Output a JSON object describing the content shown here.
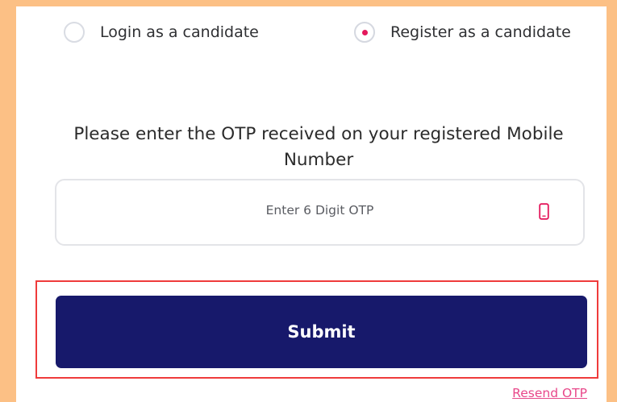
{
  "mode_selector": {
    "options": [
      {
        "label": "Login as a candidate",
        "selected": false
      },
      {
        "label": "Register as a candidate",
        "selected": true
      }
    ]
  },
  "otp_section": {
    "instruction": "Please enter the OTP received on your registered Mobile Number",
    "input_placeholder": "Enter 6 Digit OTP",
    "input_value": "",
    "input_icon": "mobile-phone-icon"
  },
  "actions": {
    "submit_label": "Submit",
    "resend_label": "Resend OTP"
  },
  "colors": {
    "page_background": "#FCC085",
    "accent": "#E4185C",
    "submit_background": "#17196B",
    "highlight_border": "#EF3B3B",
    "link": "#E8488A"
  }
}
